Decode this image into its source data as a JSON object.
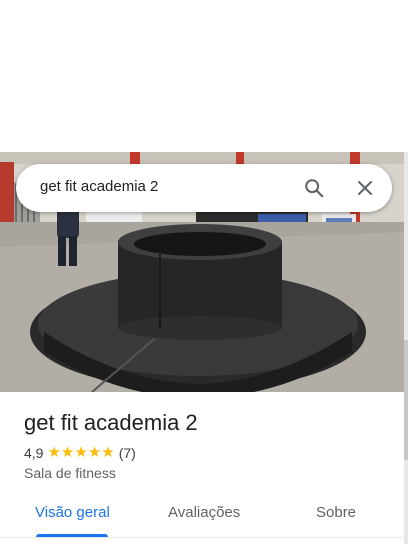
{
  "search": {
    "query": "get fit academia 2",
    "search_icon": "search-icon",
    "close_icon": "close-icon"
  },
  "place": {
    "name": "get fit academia 2",
    "rating": "4,9",
    "stars": 5,
    "review_count": "(7)",
    "category": "Sala de fitness"
  },
  "tabs": [
    {
      "label": "Visão geral",
      "active": true
    },
    {
      "label": "Avaliações",
      "active": false
    },
    {
      "label": "Sobre",
      "active": false
    }
  ],
  "colors": {
    "accent": "#1a73e8",
    "star": "#fbbc04"
  }
}
